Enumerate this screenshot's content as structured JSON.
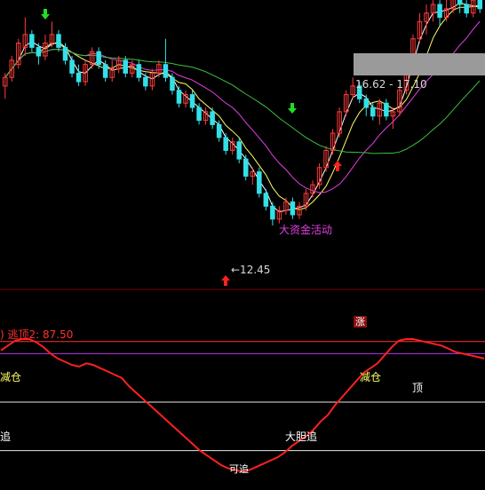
{
  "colors": {
    "background": "#000000",
    "up_candle": "#ff3b3b",
    "down_candle": "#33e0e8",
    "ma_fast": "#ffffff",
    "ma_yellow": "#ffff66",
    "ma_magenta": "#e63ee6",
    "ma_green": "#3fbf3f",
    "indicator_line": "#ff2020",
    "reference_purple": "#bb33ee",
    "marker_red": "#ff2020",
    "marker_green": "#22dd22",
    "label_magenta": "#e040e0",
    "highlight_gray": "#9a9a9a"
  },
  "labels": {
    "price_low": "←12.45",
    "price_range": "16.62 - 17.10",
    "fund_activity": "大资金活动",
    "limit_up": "涨",
    "indicator_header": ") 逃顶2: 87.50",
    "reduce_position_left": "减仓",
    "reduce_position_right": "减仓",
    "top_signal": "顶",
    "chase_left": "追",
    "bold_chase": "大胆追",
    "chase_bottom": "可追"
  },
  "icons": [
    "up-arrow-icon",
    "down-arrow-icon"
  ],
  "chart_data": [
    {
      "type": "candlestick",
      "panel": "price",
      "ylim": [
        11.5,
        17.6
      ],
      "candles": [
        [
          15.7,
          15.9,
          15.4,
          16.0
        ],
        [
          15.9,
          16.3,
          15.8,
          16.4
        ],
        [
          16.2,
          16.7,
          16.1,
          16.8
        ],
        [
          16.6,
          16.9,
          16.4,
          17.3
        ],
        [
          16.9,
          16.6,
          16.5,
          17.0
        ],
        [
          16.6,
          16.4,
          16.2,
          16.7
        ],
        [
          16.4,
          16.7,
          16.3,
          16.9
        ],
        [
          16.7,
          16.9,
          16.6,
          17.2
        ],
        [
          16.9,
          16.6,
          16.5,
          17.0
        ],
        [
          16.6,
          16.3,
          16.2,
          16.7
        ],
        [
          16.3,
          16.0,
          15.9,
          16.4
        ],
        [
          16.0,
          15.8,
          15.7,
          16.2
        ],
        [
          15.8,
          16.2,
          15.7,
          16.3
        ],
        [
          16.2,
          16.5,
          16.1,
          16.6
        ],
        [
          16.5,
          16.2,
          16.1,
          16.6
        ],
        [
          16.2,
          15.9,
          15.8,
          16.3
        ],
        [
          15.9,
          16.1,
          15.8,
          16.3
        ],
        [
          16.1,
          16.3,
          16.0,
          16.4
        ],
        [
          16.3,
          16.0,
          15.9,
          16.4
        ],
        [
          16.0,
          16.2,
          15.9,
          16.3
        ],
        [
          16.2,
          15.9,
          15.8,
          16.3
        ],
        [
          15.9,
          15.7,
          15.6,
          16.0
        ],
        [
          15.7,
          16.0,
          15.6,
          16.1
        ],
        [
          16.0,
          16.2,
          15.9,
          16.3
        ],
        [
          16.2,
          15.9,
          15.8,
          16.8
        ],
        [
          15.9,
          15.6,
          15.5,
          16.0
        ],
        [
          15.6,
          15.3,
          15.2,
          15.7
        ],
        [
          15.3,
          15.5,
          15.2,
          15.6
        ],
        [
          15.5,
          15.2,
          15.1,
          15.6
        ],
        [
          15.2,
          14.9,
          14.8,
          15.3
        ],
        [
          14.9,
          15.1,
          14.8,
          15.2
        ],
        [
          15.1,
          14.8,
          14.7,
          15.2
        ],
        [
          14.8,
          14.5,
          14.4,
          14.9
        ],
        [
          14.5,
          14.2,
          14.1,
          14.6
        ],
        [
          14.2,
          14.4,
          14.1,
          14.5
        ],
        [
          14.4,
          14.0,
          13.9,
          14.5
        ],
        [
          14.0,
          13.6,
          13.5,
          14.1
        ],
        [
          13.6,
          13.7,
          13.4,
          13.8
        ],
        [
          13.7,
          13.2,
          13.1,
          13.8
        ],
        [
          13.2,
          12.9,
          12.8,
          13.3
        ],
        [
          12.9,
          12.6,
          12.45,
          13.0
        ],
        [
          12.6,
          12.8,
          12.5,
          12.9
        ],
        [
          12.8,
          13.0,
          12.7,
          13.1
        ],
        [
          13.0,
          12.7,
          12.6,
          13.1
        ],
        [
          12.7,
          12.9,
          12.6,
          13.0
        ],
        [
          12.9,
          13.2,
          12.8,
          13.3
        ],
        [
          13.2,
          13.4,
          13.1,
          13.5
        ],
        [
          13.4,
          13.8,
          13.3,
          13.9
        ],
        [
          13.8,
          14.2,
          13.7,
          14.3
        ],
        [
          14.2,
          14.6,
          14.1,
          14.7
        ],
        [
          14.6,
          15.1,
          14.5,
          15.2
        ],
        [
          15.1,
          15.5,
          15.0,
          15.6
        ],
        [
          15.5,
          15.7,
          15.4,
          15.9
        ],
        [
          15.7,
          15.4,
          15.3,
          15.8
        ],
        [
          15.4,
          15.2,
          15.0,
          15.5
        ],
        [
          15.2,
          15.0,
          14.9,
          15.3
        ],
        [
          15.0,
          15.3,
          14.8,
          15.4
        ],
        [
          15.3,
          15.0,
          14.9,
          15.4
        ],
        [
          15.0,
          15.1,
          14.7,
          15.2
        ],
        [
          15.1,
          15.6,
          15.0,
          15.7
        ],
        [
          15.6,
          16.3,
          15.5,
          16.4
        ],
        [
          16.3,
          16.8,
          16.2,
          16.9
        ],
        [
          16.8,
          17.2,
          16.7,
          17.4
        ],
        [
          17.2,
          17.4,
          16.9,
          17.6
        ],
        [
          17.4,
          17.6,
          17.2,
          17.7
        ],
        [
          17.6,
          17.3,
          17.1,
          17.7
        ],
        [
          17.3,
          17.5,
          17.2,
          17.8
        ],
        [
          17.5,
          17.8,
          17.4,
          17.9
        ],
        [
          17.8,
          17.6,
          17.4,
          17.9
        ],
        [
          17.6,
          17.4,
          17.3,
          17.7
        ],
        [
          17.4,
          17.7,
          17.3,
          17.8
        ],
        [
          17.7,
          17.5,
          17.4,
          17.8
        ]
      ],
      "series_colors": [
        "#ffffff",
        "#ffff66",
        "#e63ee6",
        "#3fbf3f"
      ]
    },
    {
      "type": "line",
      "panel": "indicator",
      "ylim": [
        0,
        100
      ],
      "reference_lines": [
        87.5,
        80,
        50,
        20
      ],
      "values": [
        82,
        85,
        88,
        89,
        89,
        87,
        84,
        80,
        77,
        75,
        73,
        72,
        74,
        73,
        71,
        69,
        67,
        65,
        60,
        56,
        52,
        48,
        44,
        40,
        36,
        32,
        28,
        24,
        20,
        17,
        14,
        11,
        9,
        8,
        7,
        8,
        10,
        12,
        14,
        16,
        19,
        23,
        26,
        29,
        33,
        38,
        42,
        48,
        53,
        58,
        63,
        68,
        71,
        74,
        79,
        84,
        88,
        89,
        89,
        88,
        87,
        86,
        85,
        83,
        81,
        80,
        79,
        78,
        77
      ]
    }
  ]
}
